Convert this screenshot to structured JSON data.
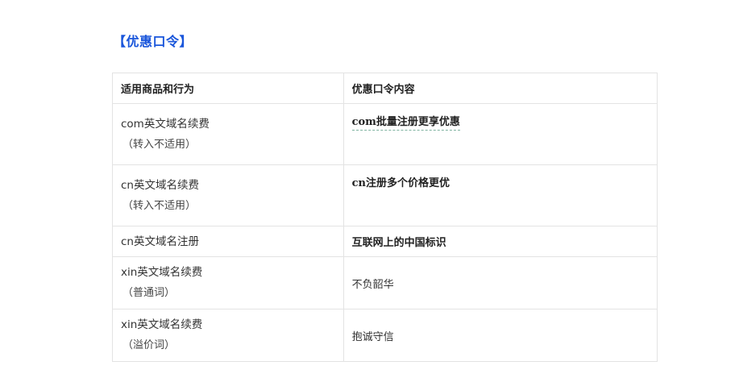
{
  "section_title": "【优惠口令】",
  "table": {
    "headers": [
      "适用商品和行为",
      "优惠口令内容"
    ],
    "rows": [
      {
        "product": "com英文域名续费",
        "note": "（转入不适用）",
        "promo": "com批量注册更享优惠"
      },
      {
        "product": "cn英文域名续费",
        "note": "（转入不适用）",
        "promo": "cn注册多个价格更优"
      },
      {
        "product": "cn英文域名注册",
        "promo": "互联网上的中国标识"
      },
      {
        "product": "xin英文域名续费",
        "note": "（普通词）",
        "promo": "不负韶华"
      },
      {
        "product": "xin英文域名续费",
        "note": "（溢价词）",
        "promo": "抱诚守信"
      }
    ]
  }
}
